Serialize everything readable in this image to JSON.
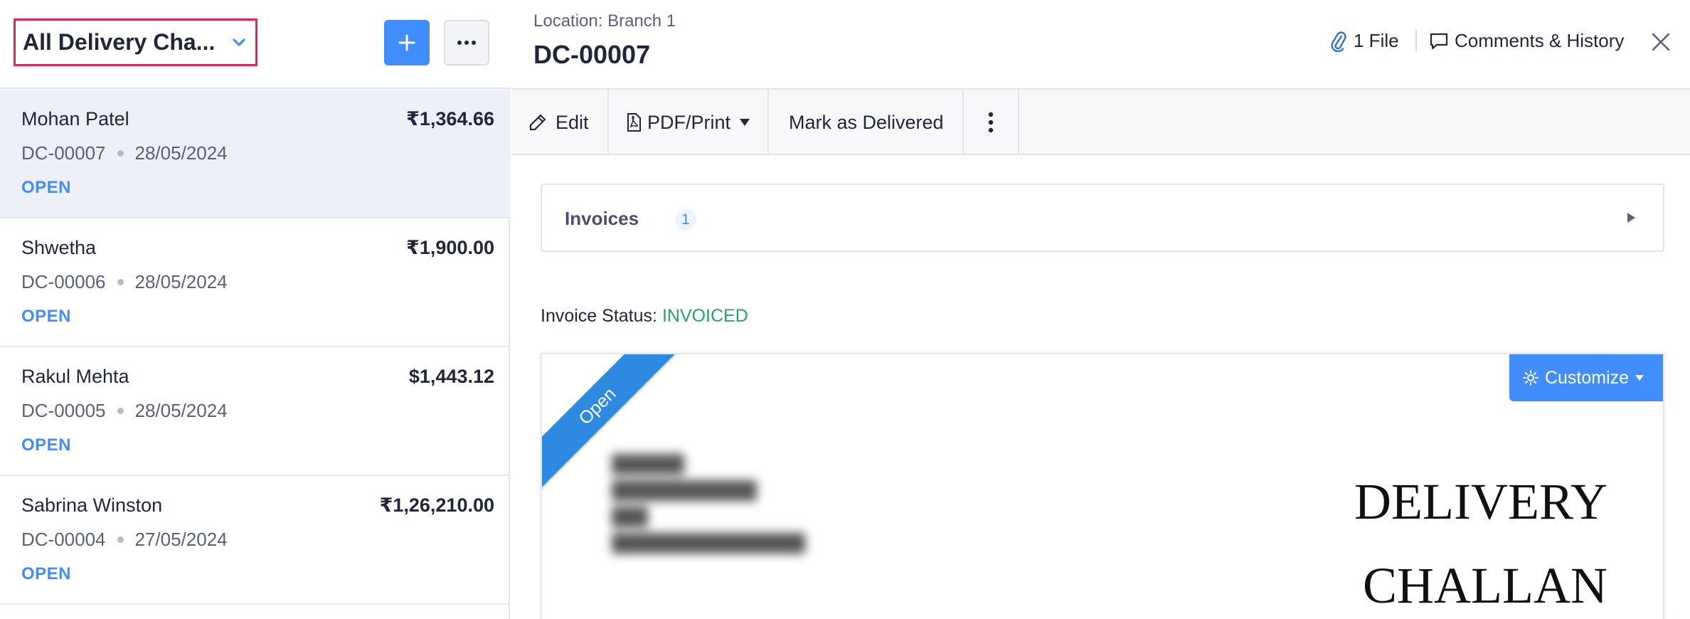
{
  "left_pane": {
    "view_selector": {
      "label": "All Delivery Cha..."
    },
    "list": [
      {
        "name": "Mohan Patel",
        "amount": "₹1,364.66",
        "number": "DC-00007",
        "date": "28/05/2024",
        "status": "OPEN",
        "active": true
      },
      {
        "name": "Shwetha",
        "amount": "₹1,900.00",
        "number": "DC-00006",
        "date": "28/05/2024",
        "status": "OPEN",
        "active": false
      },
      {
        "name": "Rakul Mehta",
        "amount": "$1,443.12",
        "number": "DC-00005",
        "date": "28/05/2024",
        "status": "OPEN",
        "active": false
      },
      {
        "name": "Sabrina Winston",
        "amount": "₹1,26,210.00",
        "number": "DC-00004",
        "date": "27/05/2024",
        "status": "OPEN",
        "active": false
      }
    ]
  },
  "detail": {
    "location": "Location: Branch 1",
    "title": "DC-00007",
    "files_label": "1 File",
    "comments_label": "Comments & History",
    "toolbar": {
      "edit_label": "Edit",
      "pdf_label": "PDF/Print",
      "mark_label": "Mark as Delivered"
    },
    "invoices": {
      "label": "Invoices",
      "count": "1"
    },
    "invoice_status": {
      "label": "Invoice Status:",
      "value": "INVOICED"
    },
    "preview": {
      "ribbon": "Open",
      "customize_label": "Customize",
      "heading_line1": "DELIVERY",
      "heading_line2": "CHALLAN"
    }
  },
  "colors": {
    "accent": "#408dfb",
    "highlight_border": "#e0245e",
    "invoiced_green": "#23a566",
    "ribbon_blue": "#2d8ae0",
    "active_row_bg": "#eef0f8"
  },
  "icons": [
    "chevron-down-icon",
    "plus-icon",
    "ellipsis-icon",
    "paperclip-icon",
    "comment-icon",
    "close-icon",
    "pencil-icon",
    "pdf-icon",
    "caret-down-icon",
    "kebab-icon",
    "triangle-right-icon",
    "gear-icon"
  ]
}
